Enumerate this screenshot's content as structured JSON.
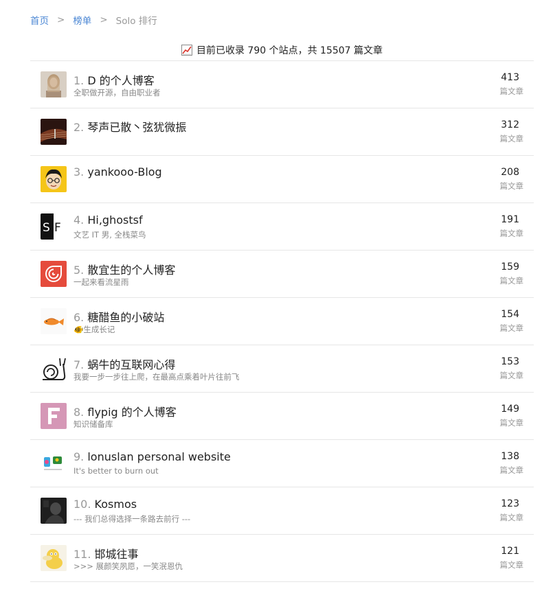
{
  "breadcrumb": {
    "home": "首页",
    "separator": ">",
    "ranking": "榜单",
    "current": "Solo 排行"
  },
  "summary": {
    "icon": "chart-increasing-icon",
    "text": "目前已收录 790 个站点，共 15507 篇文章"
  },
  "unit_label": "篇文章",
  "sites": [
    {
      "rank": "1.",
      "name": "D 的个人博客",
      "desc": "全职做开源，自由职业者",
      "count": "413",
      "avatar": "portrait-avatar"
    },
    {
      "rank": "2.",
      "name": "琴声已散丶弦犹微振",
      "desc": "",
      "count": "312",
      "avatar": "guitar-avatar"
    },
    {
      "rank": "3.",
      "name": "yankooo-Blog",
      "desc": "",
      "count": "208",
      "avatar": "cartoon-face-avatar"
    },
    {
      "rank": "4.",
      "name": "Hi,ghostsf",
      "desc": "文艺 IT 男, 全栈菜鸟",
      "count": "191",
      "avatar": "sf-logo-avatar"
    },
    {
      "rank": "5.",
      "name": "散宜生的个人博客",
      "desc": "一起来看流星雨",
      "count": "159",
      "avatar": "red-logo-avatar"
    },
    {
      "rank": "6.",
      "name": "糖醋鱼的小破站",
      "desc": "🐠生成长记",
      "count": "154",
      "avatar": "fish-avatar"
    },
    {
      "rank": "7.",
      "name": "蜗牛的互联网心得",
      "desc": "我要一步一步往上爬，在最高点乘着叶片往前飞",
      "count": "153",
      "avatar": "snail-avatar"
    },
    {
      "rank": "8.",
      "name": "flypig 的个人博客",
      "desc": "知识储备库",
      "count": "149",
      "avatar": "letter-f-avatar"
    },
    {
      "rank": "9.",
      "name": "lonuslan personal website",
      "desc": "It's better to burn out",
      "count": "138",
      "avatar": "colorful-logo-avatar"
    },
    {
      "rank": "10.",
      "name": "Kosmos",
      "desc": "--- 我们总得选择一条路去前行 ---",
      "count": "123",
      "avatar": "dark-photo-avatar"
    },
    {
      "rank": "11.",
      "name": "邯城往事",
      "desc": ">>> 展颜笑夙愿，一笑泯恩仇",
      "count": "121",
      "avatar": "psyduck-avatar"
    }
  ],
  "colors": {
    "link": "#4a86d4",
    "muted": "#999999",
    "divider": "#e6e6e6"
  }
}
